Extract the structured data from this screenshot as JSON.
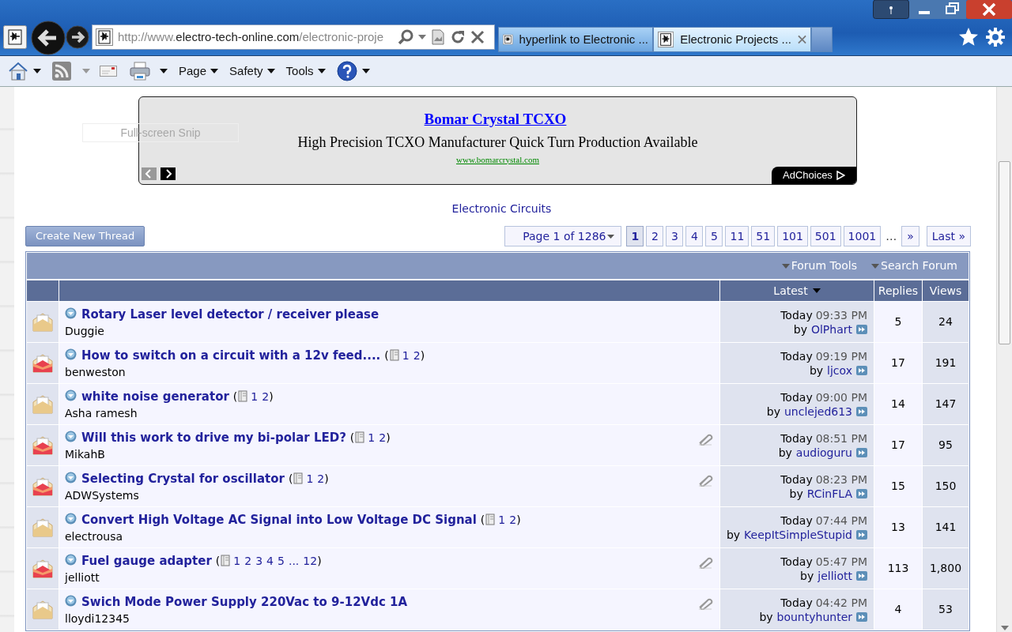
{
  "browser": {
    "tabs": [
      {
        "title": "hyperlink to Electronic ...",
        "selected": false
      },
      {
        "title": "Electronic Projects ...",
        "selected": true
      }
    ],
    "url_parts": [
      {
        "text": "http://www.",
        "kind": "dim"
      },
      {
        "text": "electro-tech-online.com",
        "kind": "domain"
      },
      {
        "text": "/electronic-proje",
        "kind": "dim"
      }
    ],
    "command_bar": [
      {
        "label": "Page"
      },
      {
        "label": "Safety"
      },
      {
        "label": "Tools"
      }
    ]
  },
  "snip_overlay": "Full-screen Snip",
  "ad": {
    "title": "Bomar Crystal TCXO",
    "text": "High Precision TCXO Manufacturer Quick Turn Production Available",
    "url": "www.bomarcrystal.com",
    "choices": "AdChoices"
  },
  "forum_title": "Electronic Circuits",
  "create_button": "Create New Thread",
  "pagination": {
    "page_menu": "Page 1 of 1286",
    "pages": [
      {
        "label": "1",
        "selected": true
      },
      {
        "label": "2",
        "selected": false
      },
      {
        "label": "3",
        "selected": false
      },
      {
        "label": "4",
        "selected": false
      },
      {
        "label": "5",
        "selected": false
      },
      {
        "label": "11",
        "selected": false
      },
      {
        "label": "51",
        "selected": false
      },
      {
        "label": "101",
        "selected": false
      },
      {
        "label": "501",
        "selected": false
      },
      {
        "label": "1001",
        "selected": false
      }
    ],
    "ellipsis": "…",
    "next": "»",
    "last": "Last »"
  },
  "toolbar": [
    "Forum Tools",
    "Search Forum"
  ],
  "columns": {
    "latest": "Latest",
    "replies": "Replies",
    "views": "Views"
  },
  "threads": [
    {
      "title": "Rotary Laser level detector / receiver please",
      "author": "Duggie",
      "hot": false,
      "attachment": false,
      "day": "Today",
      "time": "09:33 PM",
      "by": "by",
      "last_poster": "OlPhart",
      "replies": "5",
      "views": "24"
    },
    {
      "title": "How to switch on a circuit with a 12v feed....",
      "author": "benweston",
      "hot": true,
      "attachment": false,
      "pages": {
        "open": "(",
        "links": [
          "1",
          "2"
        ],
        "close": ")"
      },
      "day": "Today",
      "time": "09:19 PM",
      "by": "by",
      "last_poster": "ljcox",
      "replies": "17",
      "views": "191"
    },
    {
      "title": "white noise generator",
      "author": "Asha ramesh",
      "hot": false,
      "attachment": false,
      "pages": {
        "open": "(",
        "links": [
          "1",
          "2"
        ],
        "close": ")"
      },
      "day": "Today",
      "time": "09:00 PM",
      "by": "by",
      "last_poster": "unclejed613",
      "replies": "14",
      "views": "147"
    },
    {
      "title": "Will this work to drive my bi-polar LED?",
      "author": "MikahB",
      "hot": true,
      "attachment": true,
      "pages": {
        "open": "(",
        "links": [
          "1",
          "2"
        ],
        "close": ")"
      },
      "day": "Today",
      "time": "08:51 PM",
      "by": "by",
      "last_poster": "audioguru",
      "replies": "17",
      "views": "95"
    },
    {
      "title": "Selecting Crystal for oscillator",
      "author": "ADWSystems",
      "hot": true,
      "attachment": true,
      "pages": {
        "open": "(",
        "links": [
          "1",
          "2"
        ],
        "close": ")"
      },
      "day": "Today",
      "time": "08:23 PM",
      "by": "by",
      "last_poster": "RCinFLA",
      "replies": "15",
      "views": "150"
    },
    {
      "title": "Convert High Voltage AC Signal into Low Voltage DC Signal",
      "author": "electrousa",
      "hot": false,
      "attachment": false,
      "pages": {
        "open": "(",
        "links": [
          "1",
          "2"
        ],
        "close": ")"
      },
      "day": "Today",
      "time": "07:44 PM",
      "by": "by",
      "last_poster": "KeepItSimpleStupid",
      "replies": "13",
      "views": "141"
    },
    {
      "title": "Fuel gauge adapter",
      "author": "jelliott",
      "hot": true,
      "attachment": true,
      "pages": {
        "open": "(",
        "links": [
          "1",
          "2",
          "3",
          "4",
          "5",
          "...",
          "12"
        ],
        "close": ")"
      },
      "day": "Today",
      "time": "05:47 PM",
      "by": "by",
      "last_poster": "jelliott",
      "replies": "113",
      "views": "1,800"
    },
    {
      "title": "Swich Mode Power Supply 220Vac to 9-12Vdc 1A",
      "author": "lloydi12345",
      "hot": false,
      "attachment": true,
      "day": "Today",
      "time": "04:42 PM",
      "by": "by",
      "last_poster": "bountyhunter",
      "replies": "4",
      "views": "53"
    }
  ]
}
